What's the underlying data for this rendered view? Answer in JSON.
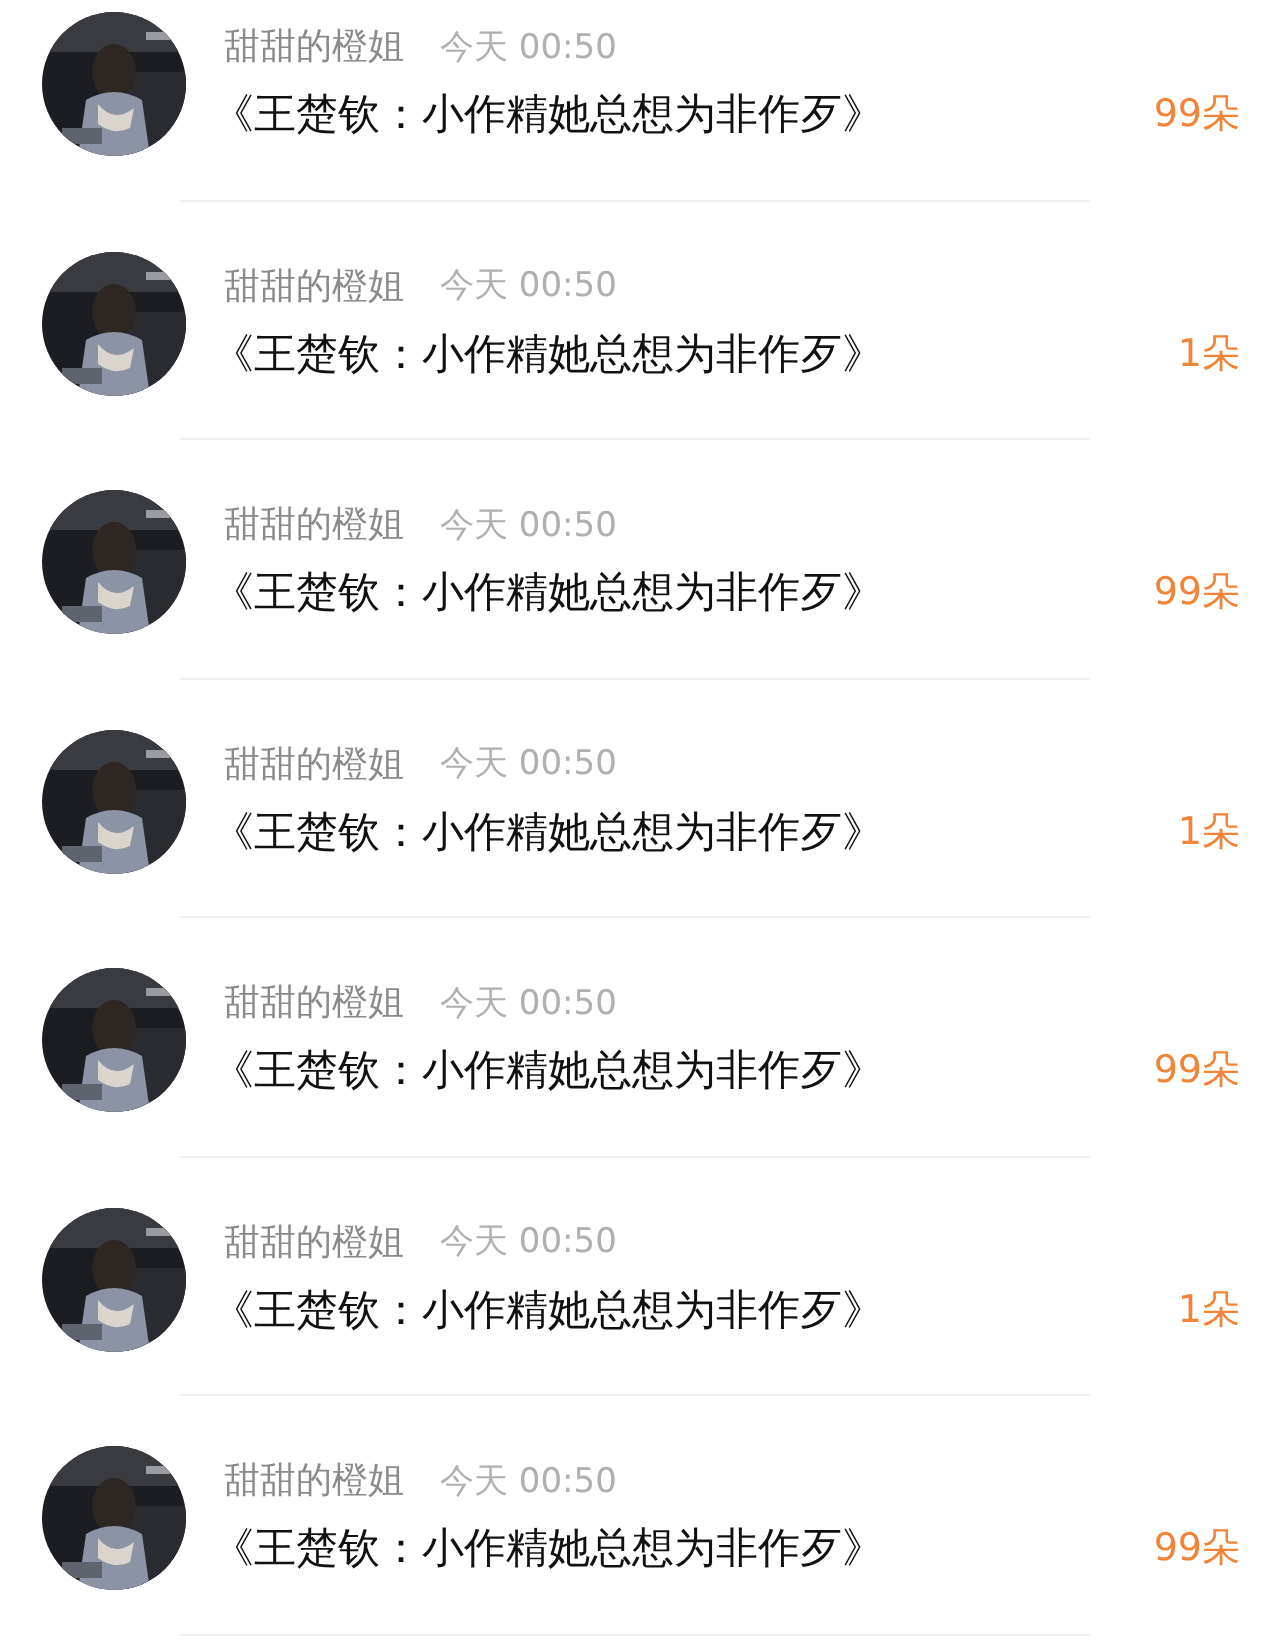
{
  "items": [
    {
      "name": "甜甜的橙姐",
      "time": "今天 00:50",
      "title": "《王楚钦：小作精她总想为非作歹》",
      "amount": "99朵"
    },
    {
      "name": "甜甜的橙姐",
      "time": "今天 00:50",
      "title": "《王楚钦：小作精她总想为非作歹》",
      "amount": "1朵"
    },
    {
      "name": "甜甜的橙姐",
      "time": "今天 00:50",
      "title": "《王楚钦：小作精她总想为非作歹》",
      "amount": "99朵"
    },
    {
      "name": "甜甜的橙姐",
      "time": "今天 00:50",
      "title": "《王楚钦：小作精她总想为非作歹》",
      "amount": "1朵"
    },
    {
      "name": "甜甜的橙姐",
      "time": "今天 00:50",
      "title": "《王楚钦：小作精她总想为非作歹》",
      "amount": "99朵"
    },
    {
      "name": "甜甜的橙姐",
      "time": "今天 00:50",
      "title": "《王楚钦：小作精她总想为非作歹》",
      "amount": "1朵"
    },
    {
      "name": "甜甜的橙姐",
      "time": "今天 00:50",
      "title": "《王楚钦：小作精她总想为非作歹》",
      "amount": "99朵"
    }
  ]
}
